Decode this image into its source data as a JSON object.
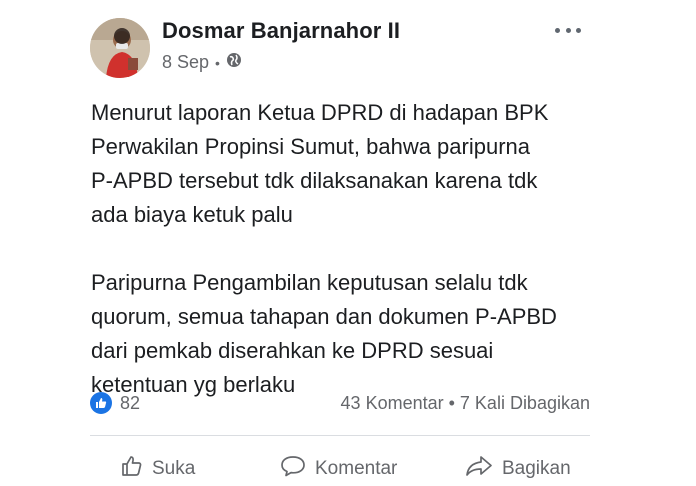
{
  "post": {
    "author": "Dosmar Banjarnahor II",
    "date": "8 Sep",
    "separator": "•",
    "paragraphs": [
      [
        "Menurut laporan Ketua DPRD di hadapan BPK",
        "Perwakilan Propinsi Sumut, bahwa paripurna",
        "P-APBD tersebut tdk dilaksanakan karena tdk",
        "ada biaya ketuk palu"
      ],
      [
        "Paripurna Pengambilan keputusan selalu tdk",
        "quorum, semua tahapan dan dokumen P-APBD",
        "dari pemkab diserahkan ke DPRD sesuai",
        "ketentuan yg berlaku"
      ]
    ]
  },
  "stats": {
    "likes": "82",
    "comments_shares": "43 Komentar • 7 Kali Dibagikan"
  },
  "actions": {
    "like": "Suka",
    "comment": "Komentar",
    "share": "Bagikan"
  },
  "icons": {
    "privacy": "globe-icon",
    "more": "more-options-icon",
    "like_badge": "thumbs-up-icon",
    "like_action": "thumbs-up-outline-icon",
    "comment_action": "speech-bubble-icon",
    "share_action": "share-arrow-icon"
  },
  "colors": {
    "accent": "#1b74e4",
    "secondary_text": "#65676b",
    "primary_text": "#1c1e21"
  }
}
